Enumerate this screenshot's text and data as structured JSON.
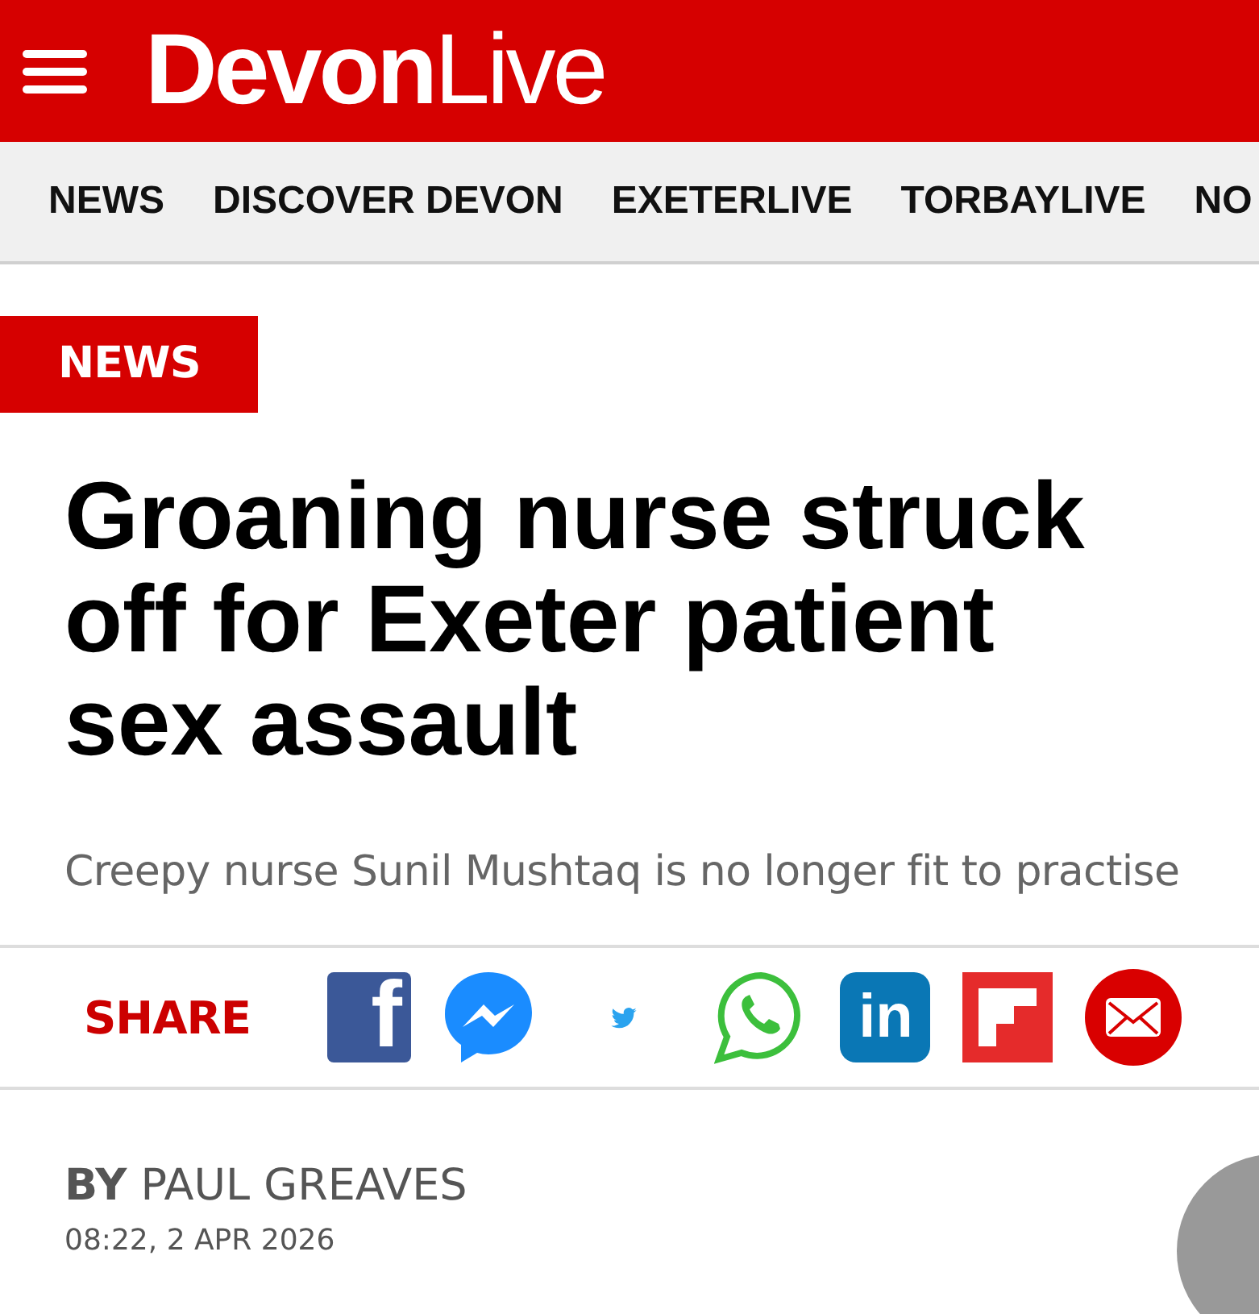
{
  "header": {
    "logo": "**Devon**Live"
  },
  "nav": [
    {
      "label": "NEWS"
    },
    {
      "label": "DISCOVER DEVON"
    },
    {
      "label": "EXETERLIVE"
    },
    {
      "label": "TORBAYLIVE"
    },
    {
      "label": "NO"
    }
  ],
  "article": {
    "section": "NEWS",
    "headline": "Groaning nurse struck off for Exeter patient sex assault",
    "standfirst": "Creepy nurse Sunil Mushtaq is no longer fit to practise"
  },
  "share": {
    "label": "SHARE",
    "items": [
      {
        "kind": "facebook",
        "label": "f"
      },
      {
        "kind": "messenger"
      },
      {
        "kind": "twitter"
      },
      {
        "kind": "whatsapp"
      },
      {
        "kind": "linkedin",
        "label": "in"
      },
      {
        "kind": "flipboard"
      },
      {
        "kind": "email"
      }
    ]
  },
  "byline": {
    "prefix": "BY",
    "author": "PAUL GREAVES",
    "date": "08:22, 2 APR 2026"
  }
}
